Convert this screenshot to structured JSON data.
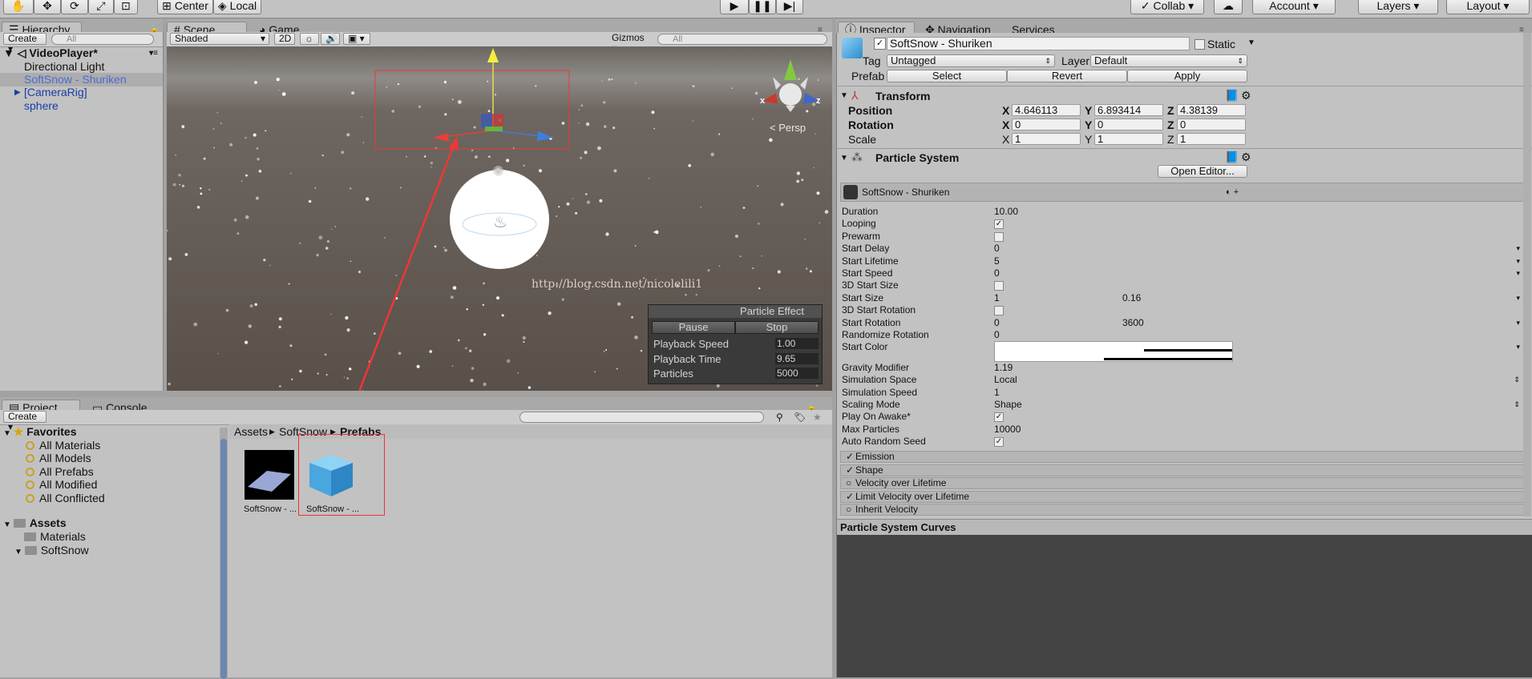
{
  "toolbar": {
    "pivot_center": "Center",
    "pivot_local": "Local",
    "collab": "Collab",
    "account": "Account",
    "layers": "Layers",
    "layout": "Layout"
  },
  "hierarchy": {
    "tab": "Hierarchy",
    "create": "Create",
    "search_placeholder": "All",
    "scene": "VideoPlayer*",
    "items": [
      {
        "label": "Directional Light"
      },
      {
        "label": "SoftSnow - Shuriken"
      },
      {
        "label": "[CameraRig]"
      },
      {
        "label": "sphere"
      }
    ]
  },
  "scene": {
    "tabs": {
      "scene": "Scene",
      "game": "Game"
    },
    "shading": "Shaded",
    "mode_2d": "2D",
    "gizmos": "Gizmos",
    "search_placeholder": "All",
    "persp": "< Persp",
    "watermark": "http://blog.csdn.net/nicolelili1",
    "axis_x": "x",
    "axis_z": "z",
    "particle_effect": {
      "title": "Particle Effect",
      "pause": "Pause",
      "stop": "Stop",
      "rows": [
        {
          "label": "Playback Speed",
          "value": "1.00"
        },
        {
          "label": "Playback Time",
          "value": "9.65"
        },
        {
          "label": "Particles",
          "value": "5000"
        }
      ]
    }
  },
  "inspector": {
    "tabs": {
      "inspector": "Inspector",
      "navigation": "Navigation",
      "services": "Services"
    },
    "object_name": "SoftSnow - Shuriken",
    "static": "Static",
    "tag_label": "Tag",
    "tag_value": "Untagged",
    "layer_label": "Layer",
    "layer_value": "Default",
    "prefab_label": "Prefab",
    "prefab_select": "Select",
    "prefab_revert": "Revert",
    "prefab_apply": "Apply",
    "transform": {
      "title": "Transform",
      "position": {
        "label": "Position",
        "x": "4.646113",
        "y": "6.893414",
        "z": "4.38139"
      },
      "rotation": {
        "label": "Rotation",
        "x": "0",
        "y": "0",
        "z": "0"
      },
      "scale": {
        "label": "Scale",
        "x": "1",
        "y": "1",
        "z": "1"
      },
      "x": "X",
      "y": "Y",
      "z": "Z"
    },
    "particle_system": {
      "title": "Particle System",
      "open_editor": "Open Editor...",
      "system_name": "SoftSnow - Shuriken",
      "rows": [
        {
          "label": "Duration",
          "value": "10.00"
        },
        {
          "label": "Looping",
          "checked": "✓"
        },
        {
          "label": "Prewarm",
          "checked": ""
        },
        {
          "label": "Start Delay",
          "value": "0"
        },
        {
          "label": "Start Lifetime",
          "value": "5"
        },
        {
          "label": "Start Speed",
          "value": "0"
        },
        {
          "label": "3D Start Size",
          "checked": ""
        },
        {
          "label": "Start Size",
          "value": "1",
          "value2": "0.16"
        },
        {
          "label": "3D Start Rotation",
          "checked": ""
        },
        {
          "label": "Start Rotation",
          "value": "0",
          "value2": "3600"
        },
        {
          "label": "Randomize Rotation",
          "value": "0"
        },
        {
          "label": "Start Color"
        },
        {
          "label": "Gravity Modifier",
          "value": "1.19"
        },
        {
          "label": "Simulation Space",
          "value": "Local"
        },
        {
          "label": "Simulation Speed",
          "value": "1"
        },
        {
          "label": "Scaling Mode",
          "value": "Shape"
        },
        {
          "label": "Play On Awake*",
          "checked": "✓"
        },
        {
          "label": "Max Particles",
          "value": "10000"
        },
        {
          "label": "Auto Random Seed",
          "checked": "✓"
        }
      ],
      "modules": [
        {
          "label": "Emission",
          "checked": "✓"
        },
        {
          "label": "Shape",
          "checked": "✓"
        },
        {
          "label": "Velocity over Lifetime",
          "checked": ""
        },
        {
          "label": "Limit Velocity over Lifetime",
          "checked": "✓"
        },
        {
          "label": "Inherit Velocity",
          "checked": ""
        }
      ]
    },
    "curves_title": "Particle System Curves"
  },
  "project": {
    "tabs": {
      "project": "Project",
      "console": "Console"
    },
    "create": "Create",
    "favorites": {
      "title": "Favorites",
      "items": [
        "All Materials",
        "All Models",
        "All Prefabs",
        "All Modified",
        "All Conflicted"
      ]
    },
    "assets": {
      "title": "Assets",
      "items": [
        "Materials",
        "SoftSnow"
      ]
    },
    "breadcrumb": [
      "Assets",
      "SoftSnow",
      "Prefabs"
    ],
    "files": [
      {
        "label": "SoftSnow - ..."
      },
      {
        "label": "SoftSnow - ..."
      }
    ]
  }
}
